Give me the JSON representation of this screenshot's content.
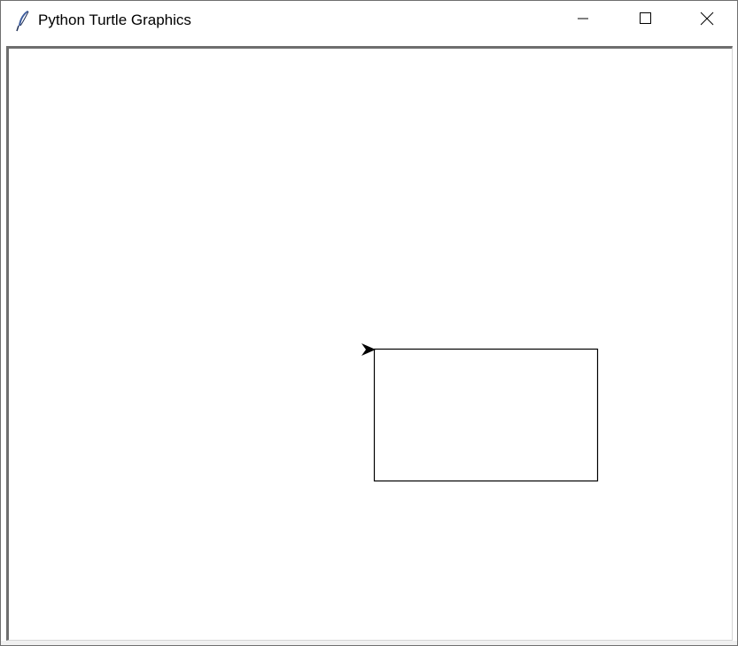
{
  "window": {
    "title": "Python Turtle Graphics",
    "icon": "feather-icon"
  },
  "controls": {
    "minimize_icon": "minimize-icon",
    "maximize_icon": "maximize-icon",
    "close_icon": "close-icon"
  },
  "canvas": {
    "background": "#ffffff",
    "pen_color": "#000000",
    "shape": "rectangle",
    "turtle_shape": "arrow",
    "turtle_heading": "east"
  }
}
